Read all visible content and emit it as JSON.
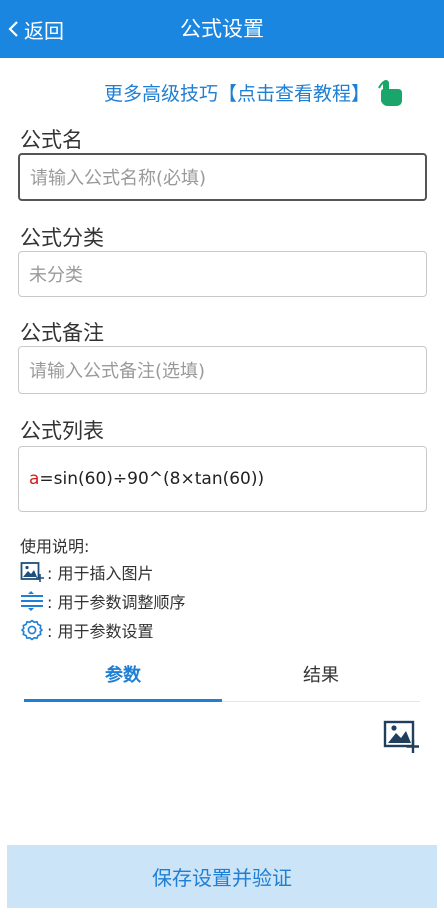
{
  "header": {
    "back_label": "返回",
    "title": "公式设置"
  },
  "tips": {
    "text": "更多高级技巧【点击查看教程】",
    "icon": "pointing-hand-icon"
  },
  "form": {
    "name_label": "公式名",
    "name_placeholder": "请输入公式名称(必填)",
    "category_label": "公式分类",
    "category_value": "未分类",
    "note_label": "公式备注",
    "note_placeholder": "请输入公式备注(选填)",
    "list_label": "公式列表",
    "formula": {
      "variable": "a",
      "expression": "=sin(60)÷90^(8×tan(60))"
    }
  },
  "help": {
    "title": "使用说明:",
    "items": [
      {
        "icon": "insert-image-icon",
        "text": ": 用于插入图片"
      },
      {
        "icon": "reorder-icon",
        "text": ": 用于参数调整顺序"
      },
      {
        "icon": "gear-icon",
        "text": ": 用于参数设置"
      }
    ]
  },
  "tabs": [
    {
      "label": "参数",
      "active": true
    },
    {
      "label": "结果",
      "active": false
    }
  ],
  "save_button": "保存设置并验证",
  "colors": {
    "header_bg": "#1a86e0",
    "accent": "#1f7fd4",
    "variable_red": "#d11c1c",
    "save_bg": "#cce4f8",
    "tips_icon": "#1aa56a"
  }
}
